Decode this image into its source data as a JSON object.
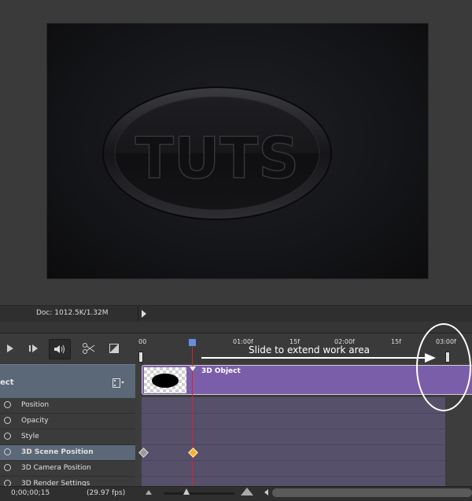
{
  "canvas": {
    "logo_text": "TUTS"
  },
  "status_bar": {
    "doc_info": "Doc: 1012.5K/1.32M"
  },
  "timeline": {
    "ruler_ticks": [
      "00",
      "01:00f",
      "15f",
      "02:00f",
      "15f",
      "03:00f"
    ],
    "layer_name": "ect",
    "clip_name": "3D Object",
    "properties": [
      {
        "label": "Position",
        "active": false
      },
      {
        "label": "Opacity",
        "active": false
      },
      {
        "label": "Style",
        "active": false
      },
      {
        "label": "3D Scene Position",
        "active": true
      },
      {
        "label": "3D Camera Position",
        "active": false
      },
      {
        "label": "3D Render Settings",
        "active": false
      }
    ],
    "annotation": "Slide to extend work area"
  },
  "bottom_bar": {
    "timecode": "0;00;00;15",
    "fps": "(29.97 fps)"
  },
  "colors": {
    "clip": "#7b5ea9",
    "playhead": "#d0272e",
    "keyframe_active": "#f0b232"
  },
  "icons": [
    "play-icon",
    "step-forward-icon",
    "audio-icon",
    "scissors-icon",
    "transition-icon",
    "film-icon",
    "stopwatch-icon"
  ]
}
